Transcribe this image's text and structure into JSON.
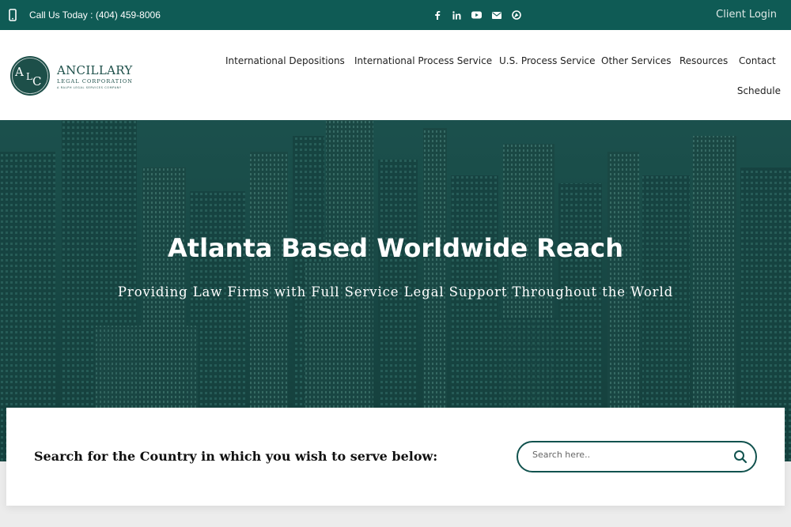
{
  "topbar": {
    "phone_text": "Call Us Today : (404) 459-8006",
    "social_icons": [
      "facebook-icon",
      "linkedin-icon",
      "youtube-icon",
      "email-icon",
      "blog-icon"
    ],
    "client_login": "Client Login"
  },
  "logo": {
    "monogram": "ALC",
    "name": "ANCILLARY",
    "subtitle": "LEGAL CORPORATION",
    "tagline": "A RALPH LEGAL SERVICES COMPANY"
  },
  "nav": {
    "items": [
      {
        "label": "International Depositions"
      },
      {
        "label": "International Process Service"
      },
      {
        "label": "U.S. Process Service"
      },
      {
        "label": "Other Services"
      },
      {
        "label": "Resources"
      },
      {
        "label": "Contact"
      },
      {
        "label": "Schedule"
      }
    ]
  },
  "hero": {
    "title": "Atlanta Based Worldwide Reach",
    "subtitle": "Providing Law Firms with Full Service Legal Support Throughout the World"
  },
  "search": {
    "label": "Search for the Country in which you wish to serve below:",
    "placeholder": "Search here.."
  },
  "colors": {
    "brand": "#0f5b55",
    "hero_overlay": "#1d4f4b",
    "text_dark": "#111111"
  }
}
